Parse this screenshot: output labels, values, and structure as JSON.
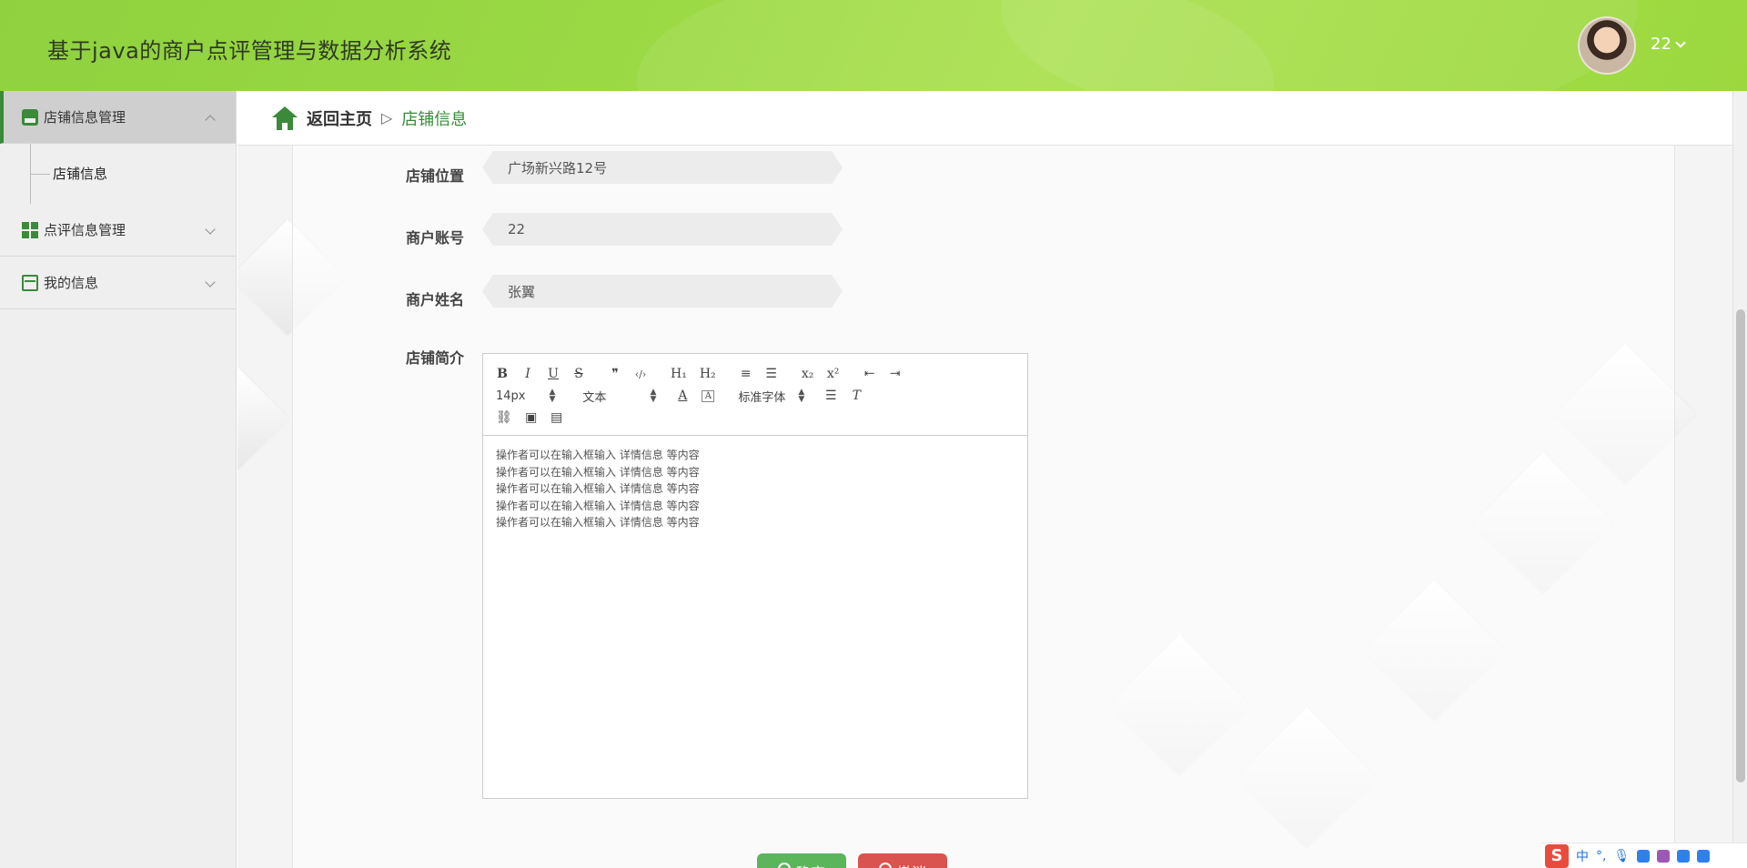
{
  "app": {
    "title": "基于java的商户点评管理与数据分析系统"
  },
  "user": {
    "name": "22"
  },
  "sidebar": {
    "items": [
      {
        "label": "店铺信息管理",
        "expanded": true,
        "icon": "store-icon"
      },
      {
        "label": "点评信息管理",
        "expanded": false,
        "icon": "grid-icon"
      },
      {
        "label": "我的信息",
        "expanded": false,
        "icon": "card-icon"
      }
    ],
    "subitems": [
      {
        "label": "店铺信息"
      }
    ]
  },
  "breadcrumb": {
    "home": "返回主页",
    "separator": "▷",
    "current": "店铺信息"
  },
  "form": {
    "location": {
      "label": "店铺位置",
      "value": "广场新兴路12号"
    },
    "account": {
      "label": "商户账号",
      "value": "22"
    },
    "name": {
      "label": "商户姓名",
      "value": "张翼"
    },
    "intro": {
      "label": "店铺简介"
    }
  },
  "editor": {
    "toolbar": {
      "row1": [
        "B",
        "I",
        "U",
        "S",
        "❞",
        "‹/›",
        "H₁",
        "H₂",
        "≡",
        "☰",
        "x₂",
        "x²",
        "⇤",
        "⇥"
      ],
      "font_size": "14px",
      "block_format": "文本",
      "font_family": "标准字体"
    },
    "lines": [
      "操作者可以在输入框输入  详情信息  等内容",
      "操作者可以在输入框输入  详情信息  等内容",
      "操作者可以在输入框输入  详情信息  等内容",
      "操作者可以在输入框输入  详情信息  等内容",
      "操作者可以在输入框输入  详情信息  等内容"
    ]
  },
  "buttons": {
    "confirm": "确定",
    "cancel": "撤消"
  },
  "ime": {
    "logo": "S",
    "mode": "中"
  },
  "colors": {
    "accent": "#3a8a3a",
    "header": "#9ad944",
    "confirm": "#5bb55b",
    "cancel": "#d9534f"
  }
}
